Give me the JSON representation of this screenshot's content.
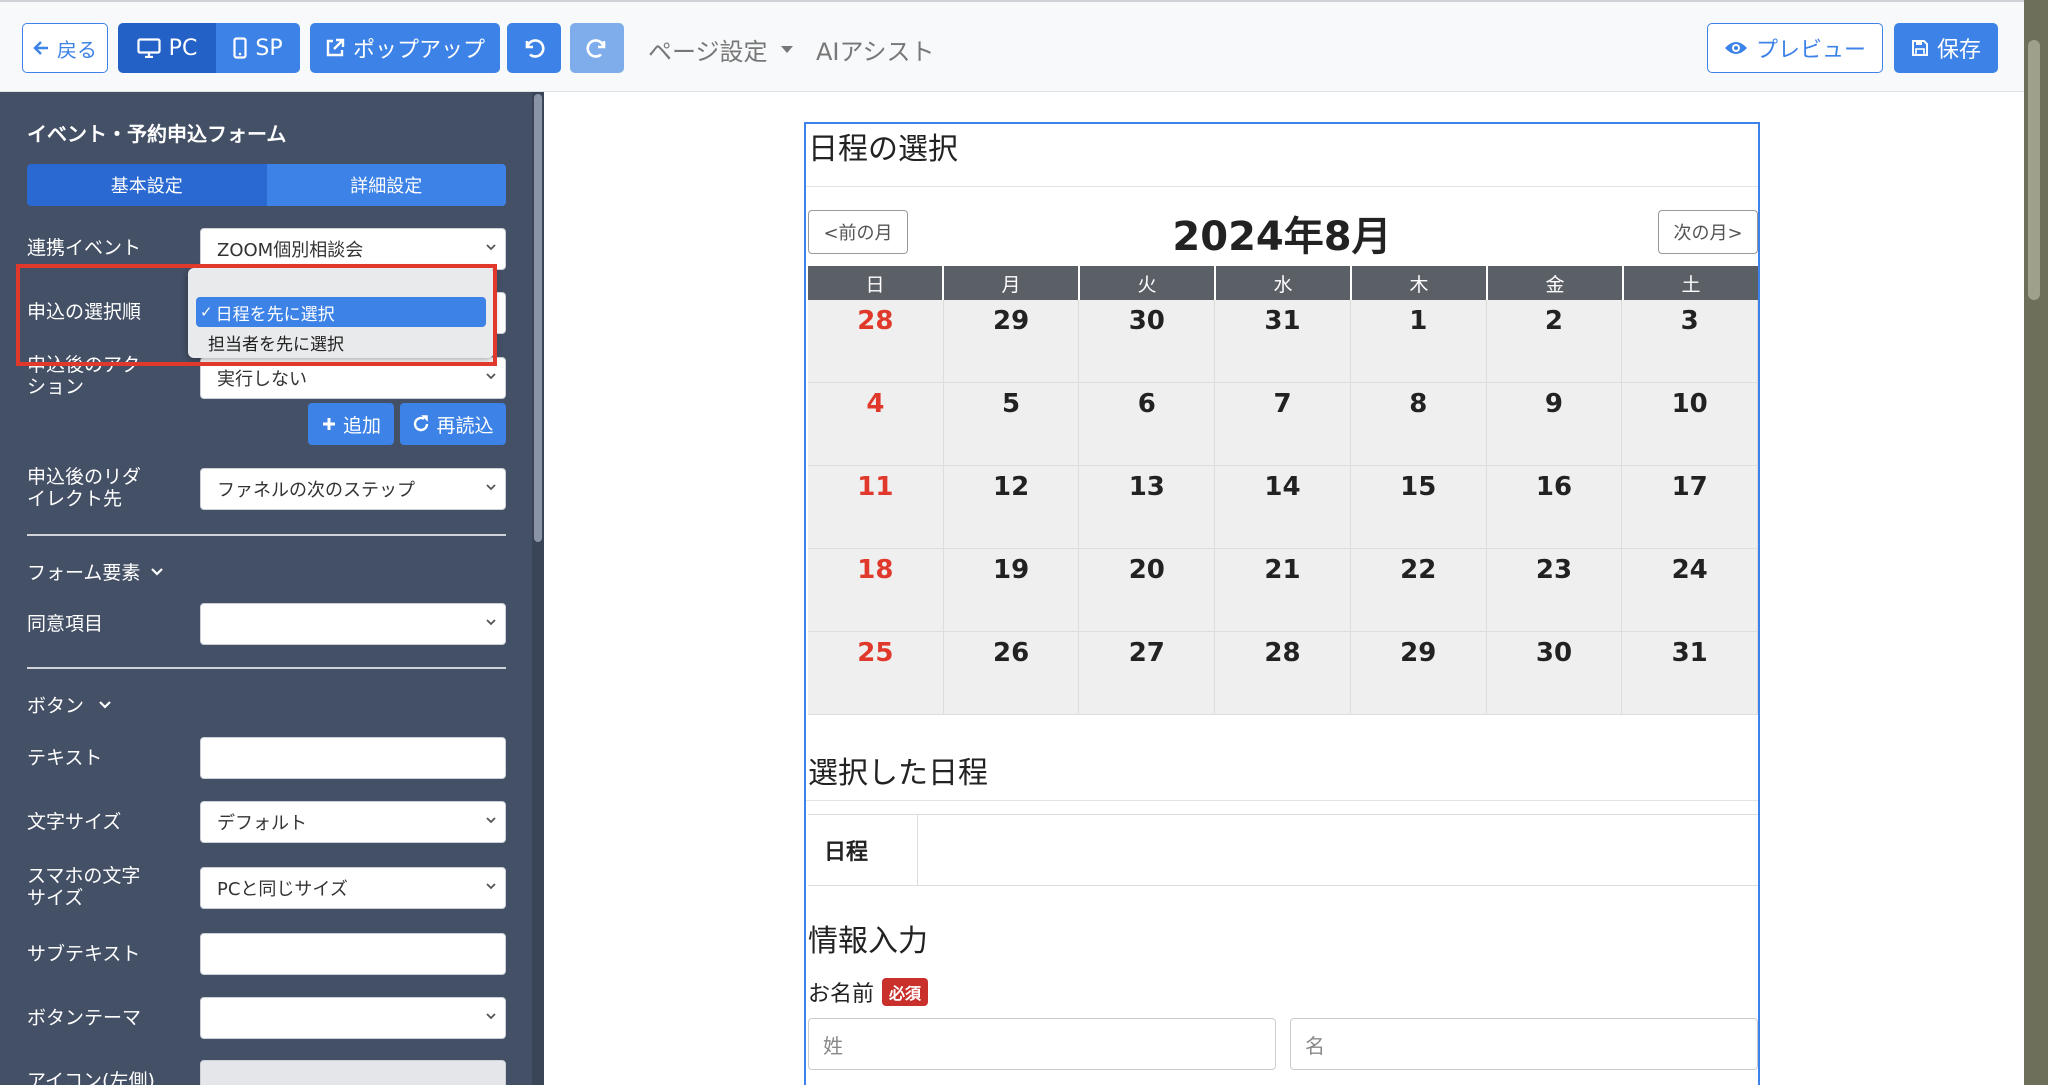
{
  "toolbar": {
    "back_label": "戻る",
    "pc_label": "PC",
    "sp_label": "SP",
    "popup_label": "ポップアップ",
    "page_settings_label": "ページ設定",
    "ai_assist_label": "AIアシスト",
    "preview_label": "プレビュー",
    "save_label": "保存"
  },
  "sidebar": {
    "title": "イベント・予約申込フォーム",
    "tabs": [
      "基本設定",
      "詳細設定"
    ],
    "linked_event": {
      "label": "連携イベント",
      "value": "ZOOM個別相談会"
    },
    "selection_order": {
      "label": "申込の選択順",
      "options": [
        "日程を先に選択",
        "担当者を先に選択"
      ],
      "selected": "日程を先に選択"
    },
    "post_action": {
      "label_line1": "申込後のアク",
      "label_line2": "ション",
      "value": "実行しない"
    },
    "add_label": "追加",
    "reload_label": "再読込",
    "redirect": {
      "label_line1": "申込後のリダ",
      "label_line2": "イレクト先",
      "value": "ファネルの次のステップ"
    },
    "form_elements_label": "フォーム要素",
    "consent": {
      "label": "同意項目",
      "value": ""
    },
    "button_section_label": "ボタン",
    "text": {
      "label": "テキスト",
      "value": ""
    },
    "font_size": {
      "label": "文字サイズ",
      "value": "デフォルト"
    },
    "sp_font_size": {
      "label_line1": "スマホの文字",
      "label_line2": "サイズ",
      "value": "PCと同じサイズ"
    },
    "subtext": {
      "label": "サブテキスト",
      "value": ""
    },
    "button_theme": {
      "label": "ボタンテーマ",
      "value": ""
    },
    "icon_left": {
      "label": "アイコン(左側)"
    }
  },
  "form": {
    "schedule_heading": "日程の選択",
    "prev_month": "<前の月",
    "next_month": "次の月>",
    "month_title": "2024年8月",
    "weekdays": [
      "日",
      "月",
      "火",
      "水",
      "木",
      "金",
      "土"
    ],
    "weeks": [
      [
        "28",
        "29",
        "30",
        "31",
        "1",
        "2",
        "3"
      ],
      [
        "4",
        "5",
        "6",
        "7",
        "8",
        "9",
        "10"
      ],
      [
        "11",
        "12",
        "13",
        "14",
        "15",
        "16",
        "17"
      ],
      [
        "18",
        "19",
        "20",
        "21",
        "22",
        "23",
        "24"
      ],
      [
        "25",
        "26",
        "27",
        "28",
        "29",
        "30",
        "31"
      ]
    ],
    "selected_heading": "選択した日程",
    "schedule_row_label": "日程",
    "info_heading": "情報入力",
    "name_label": "お名前",
    "required_badge": "必須",
    "last_name_placeholder": "姓",
    "first_name_placeholder": "名"
  },
  "colors": {
    "accent": "#3d82e6",
    "sidebar": "#445066",
    "sunday": "#e0392b",
    "highlight_box": "#e0392b"
  }
}
